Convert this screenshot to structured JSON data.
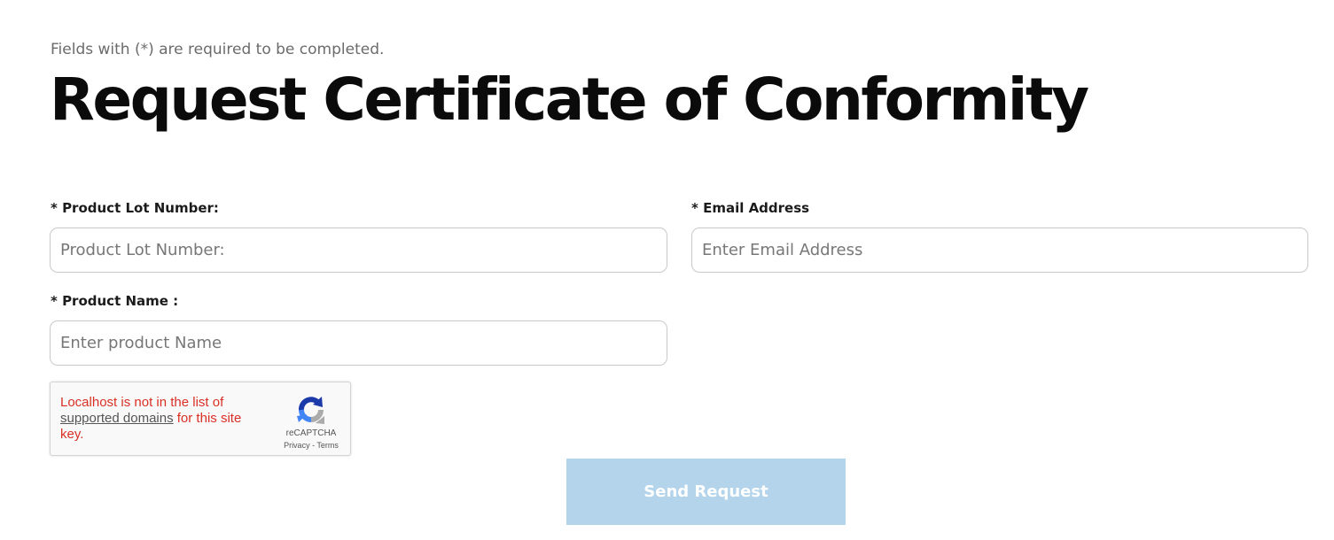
{
  "form": {
    "required_note": "Fields with (*) are required to be completed.",
    "title": "Request Certificate of Conformity",
    "fields": {
      "lot_number": {
        "label": "* Product Lot Number:",
        "placeholder": "Product Lot Number:",
        "value": ""
      },
      "email": {
        "label": "* Email Address",
        "placeholder": "Enter Email Address",
        "value": ""
      },
      "product_name": {
        "label": "* Product Name :",
        "placeholder": "Enter product Name",
        "value": ""
      }
    },
    "captcha": {
      "error_prefix": "Localhost is not in the list of ",
      "error_link": "supported domains",
      "error_suffix": " for this site key.",
      "brand": "reCAPTCHA",
      "privacy": "Privacy",
      "separator": " - ",
      "terms": "Terms"
    },
    "submit_label": "Send Request"
  },
  "colors": {
    "button_bg": "#b3d4ea",
    "error_text": "#d93025",
    "recaptcha_blue_dark": "#1c3aa9",
    "recaptcha_blue": "#4285f4",
    "recaptcha_gray": "#ababab"
  },
  "icons": {
    "recaptcha_logo": "recaptcha-logo-icon"
  }
}
